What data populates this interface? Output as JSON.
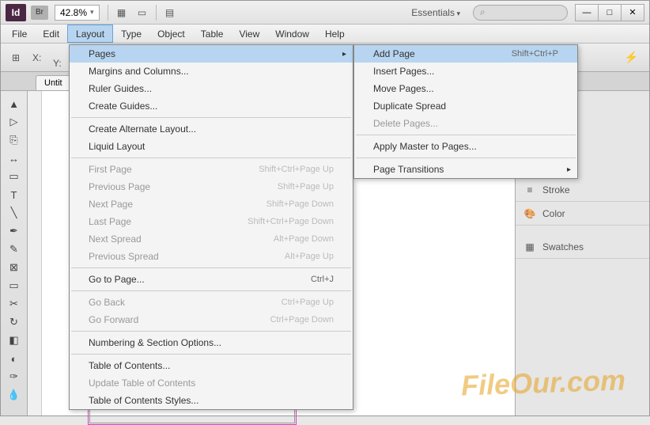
{
  "titlebar": {
    "app_badge": "Id",
    "bridge_badge": "Br",
    "zoom": "42.8%",
    "workspace": "Essentials",
    "search_placeholder": ""
  },
  "menubar": {
    "items": [
      "File",
      "Edit",
      "Layout",
      "Type",
      "Object",
      "Table",
      "View",
      "Window",
      "Help"
    ],
    "active_index": 2
  },
  "controlbar": {
    "x_label": "X:",
    "y_label": "Y:"
  },
  "doc_tab": "Untit",
  "layout_menu": [
    {
      "label": "Pages",
      "type": "submenu",
      "hover": true
    },
    {
      "label": "Margins and Columns..."
    },
    {
      "label": "Ruler Guides..."
    },
    {
      "label": "Create Guides..."
    },
    {
      "type": "sep"
    },
    {
      "label": "Create Alternate Layout..."
    },
    {
      "label": "Liquid Layout"
    },
    {
      "type": "sep"
    },
    {
      "label": "First Page",
      "shortcut": "Shift+Ctrl+Page Up",
      "disabled": true
    },
    {
      "label": "Previous Page",
      "shortcut": "Shift+Page Up",
      "disabled": true
    },
    {
      "label": "Next Page",
      "shortcut": "Shift+Page Down",
      "disabled": true
    },
    {
      "label": "Last Page",
      "shortcut": "Shift+Ctrl+Page Down",
      "disabled": true
    },
    {
      "label": "Next Spread",
      "shortcut": "Alt+Page Down",
      "disabled": true
    },
    {
      "label": "Previous Spread",
      "shortcut": "Alt+Page Up",
      "disabled": true
    },
    {
      "type": "sep"
    },
    {
      "label": "Go to Page...",
      "shortcut": "Ctrl+J"
    },
    {
      "type": "sep"
    },
    {
      "label": "Go Back",
      "shortcut": "Ctrl+Page Up",
      "disabled": true
    },
    {
      "label": "Go Forward",
      "shortcut": "Ctrl+Page Down",
      "disabled": true
    },
    {
      "type": "sep"
    },
    {
      "label": "Numbering & Section Options..."
    },
    {
      "type": "sep"
    },
    {
      "label": "Table of Contents..."
    },
    {
      "label": "Update Table of Contents",
      "disabled": true
    },
    {
      "label": "Table of Contents Styles..."
    }
  ],
  "pages_submenu": [
    {
      "label": "Add Page",
      "shortcut": "Shift+Ctrl+P",
      "hover": true
    },
    {
      "label": "Insert Pages..."
    },
    {
      "label": "Move Pages..."
    },
    {
      "label": "Duplicate Spread"
    },
    {
      "label": "Delete Pages...",
      "disabled": true
    },
    {
      "type": "sep"
    },
    {
      "label": "Apply Master to Pages..."
    },
    {
      "type": "sep"
    },
    {
      "label": "Page Transitions",
      "type": "submenu"
    }
  ],
  "right_panels": {
    "stroke": "Stroke",
    "color": "Color",
    "swatches": "Swatches"
  },
  "watermark": "FileOur.com"
}
